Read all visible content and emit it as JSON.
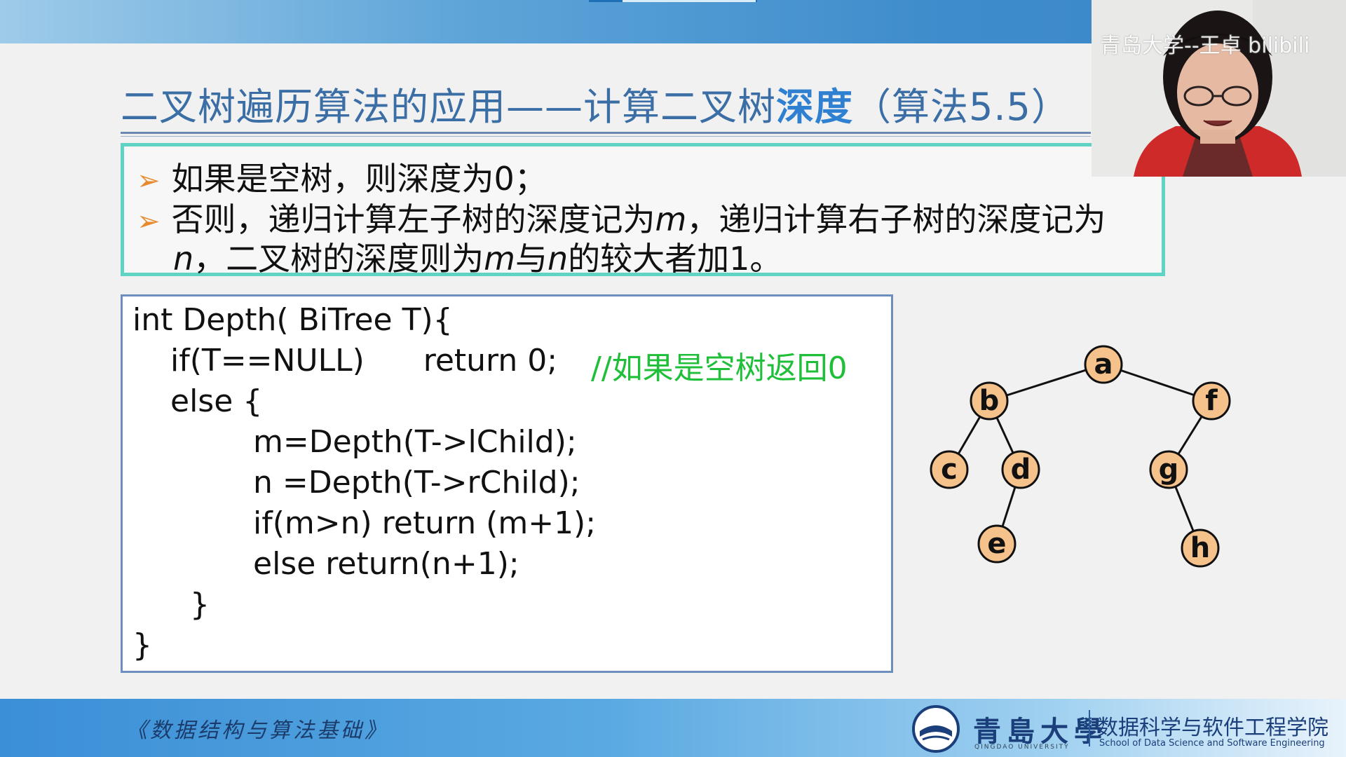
{
  "slide": {
    "title_prefix": "二叉树遍历算法的应用——计算二叉树",
    "title_emphasis": "深度",
    "title_suffix": "（算法5.5）",
    "bullets": {
      "b1": "如果是空树，则深度为0；",
      "b2_a": "否则，递归计算左子树的深度记为",
      "b2_m": "m",
      "b2_b": "，递归计算右子树的深度记为",
      "b3_n": "n",
      "b3_a": "，二叉树的深度则为",
      "b3_m": "m",
      "b3_b": "与",
      "b3_n2": "n",
      "b3_c": "的较大者加1。"
    },
    "code": {
      "l1": "int Depth( BiTree T){",
      "l2": "if(T==NULL)      return 0;",
      "l2_comment": "//如果是空树返回0",
      "l3": "else {",
      "l4": "m=Depth(T->lChild);",
      "l5": "n =Depth(T->rChild);",
      "l6": "if(m>n) return (m+1);",
      "l7": "else return(n+1);",
      "l8": "}",
      "l9": "}"
    },
    "tree": {
      "nodes": [
        "a",
        "b",
        "f",
        "c",
        "d",
        "g",
        "e",
        "h"
      ],
      "edges": [
        [
          "a",
          "b"
        ],
        [
          "a",
          "f"
        ],
        [
          "b",
          "c"
        ],
        [
          "b",
          "d"
        ],
        [
          "d",
          "e"
        ],
        [
          "f",
          "g"
        ],
        [
          "g",
          "h"
        ]
      ],
      "node_fill": "#f5c28c"
    }
  },
  "footer": {
    "book_title": "《数据结构与算法基础》",
    "university": "青島大學",
    "university_en": "QINGDAO UNIVERSITY",
    "school": "数据科学与软件工程学院",
    "school_en": "School of Data Science and Software Engineering"
  },
  "webcam": {
    "watermark": "青岛大学--王卓 bilibili"
  },
  "colors": {
    "title": "#3a6ea5",
    "title_emphasis": "#2f80d0",
    "note_border": "#5fd3c4",
    "bullet_arrow": "#e8892c",
    "comment": "#1fbf3a",
    "code_border": "#6d8fbf"
  }
}
